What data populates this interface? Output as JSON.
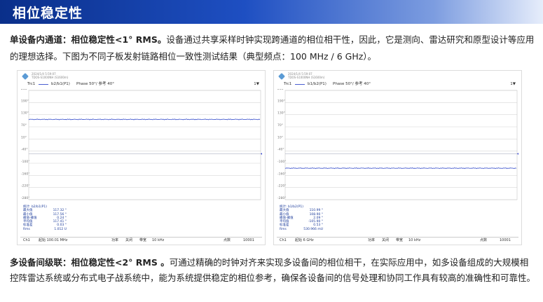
{
  "banner": {
    "title": "相位稳定性"
  },
  "para1": {
    "lead": "单设备内通道：相位稳定性<1° RMS。",
    "body": "设备通过共享采样时钟实现跨通道的相位相干性，因此，它是测向、雷达研究和原型设计等应用的理想选择。下图为不同子板发射链路相位一致性测试结果（典型频点：100 MHz / 6 GHz）。"
  },
  "para2": {
    "lead": "多设备间级联：相位稳定性<2° RMS 。",
    "body": "可通过精确的时钟对齐来实现多设备间的相位相干，在实际应用中，如多设备组成的大规模相控阵雷达系统或分布式电子战系统中，能为系统提供稳定的相位参考，确保各设备间的信号处理和协同工作具有较高的准确性和可靠性。"
  },
  "charts": [
    {
      "header_line1": "2024/1/4 5:59:07",
      "header_line2": "TDOS-S1000NH (S1600m)",
      "trace_name": "Trc1",
      "measurement": "b2/b1(P1)",
      "phase_info": "Phase 50°/ 参考 40°",
      "dropdown": "1▼",
      "marker_title": "统计: b2/b1(P1)",
      "marker_rows": [
        {
          "label": "最大值",
          "value": "117.32 °"
        },
        {
          "label": "最小值",
          "value": "117.56 °"
        },
        {
          "label": "峰值-峰值",
          "value": "0.24 °"
        },
        {
          "label": "平均值",
          "value": "117.41 °"
        },
        {
          "label": "标准差",
          "value": "0.03 °"
        },
        {
          "label": "Rms",
          "value": "1.012 U"
        }
      ],
      "footer": {
        "ch": "Ch1",
        "start": "起始 100.01 MHz",
        "pwr": "功率",
        "off": "关闭",
        "bw": "带宽",
        "bwval": "10 kHz",
        "stop_label": "点数",
        "stop": "10001"
      }
    },
    {
      "header_line1": "2024/1/4 5:59:07",
      "header_line2": "TDOS-S1000NH (S1600m)",
      "trace_name": "Trc1",
      "measurement": "b1/b2(P1)",
      "phase_info": "Phase 50°/ 参考 40°",
      "dropdown": "1▼",
      "marker_title": "统计: b1/b2(P1)",
      "marker_rows": [
        {
          "label": "最大值",
          "value": "110.99 °"
        },
        {
          "label": "最小值",
          "value": "108.90 °"
        },
        {
          "label": "峰值-峰值",
          "value": "2.09 °"
        },
        {
          "label": "平均值",
          "value": "-105.90 °"
        },
        {
          "label": "标准差",
          "value": "0.53 °"
        },
        {
          "label": "Rms",
          "value": "530.966 mU"
        }
      ],
      "footer": {
        "ch": "Ch1",
        "start": "起始 6 GHz",
        "pwr": "功率",
        "off": "关闭",
        "bw": "带宽",
        "bwval": "10 kHz",
        "stop_label": "点数",
        "stop": "10001"
      }
    }
  ],
  "chart_data": [
    {
      "type": "line",
      "title": "",
      "ylabel": "",
      "xlabel": "",
      "yticks": [
        "250°",
        "190°",
        "130°",
        "70°",
        "10°",
        "-40°",
        "-100°",
        "-160°",
        "-220°",
        "-280°"
      ],
      "ylim": [
        -250,
        250
      ],
      "ref_level": -40,
      "series": [
        {
          "values": [
            117.4
          ]
        }
      ],
      "colors": {
        "trace": "#4a5fd0",
        "ref": "#2233cc"
      }
    },
    {
      "type": "line",
      "title": "",
      "ylabel": "",
      "xlabel": "",
      "yticks": [
        "250°",
        "190°",
        "130°",
        "70°",
        "10°",
        "-40°",
        "-100°",
        "-160°",
        "-220°",
        "-280°"
      ],
      "ylim": [
        -250,
        250
      ],
      "ref_level": -40,
      "series": [
        {
          "values": [
            -105.9
          ]
        }
      ],
      "colors": {
        "trace": "#4a5fd0",
        "ref": "#2233cc"
      }
    }
  ]
}
